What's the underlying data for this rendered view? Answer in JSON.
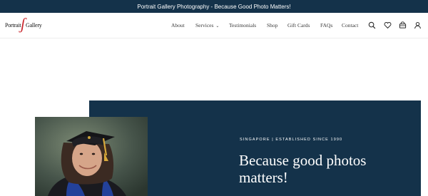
{
  "announcement": "Portrait Gallery Photography - Because Good Photo Matters!",
  "logo": {
    "text_part1": "Portrait",
    "text_part2": "Gallery",
    "accent_color": "#c9252c"
  },
  "nav": {
    "items": [
      {
        "label": "About"
      },
      {
        "label": "Services",
        "has_dropdown": true
      },
      {
        "label": "Testimonials"
      },
      {
        "label": "Shop"
      },
      {
        "label": "Gift Cards"
      },
      {
        "label": "FAQs"
      },
      {
        "label": "Contact"
      }
    ],
    "icons": [
      "search-icon",
      "heart-icon",
      "cart-icon",
      "user-icon"
    ]
  },
  "hero": {
    "eyebrow": "SINGAPORE | ESTABLISHED SINCE 1990",
    "headline": "Because good photos matters!",
    "background_color": "#14324a"
  },
  "colors": {
    "announcement_bg": "#14324a",
    "text_dark": "#3a3a3a",
    "white": "#ffffff"
  }
}
